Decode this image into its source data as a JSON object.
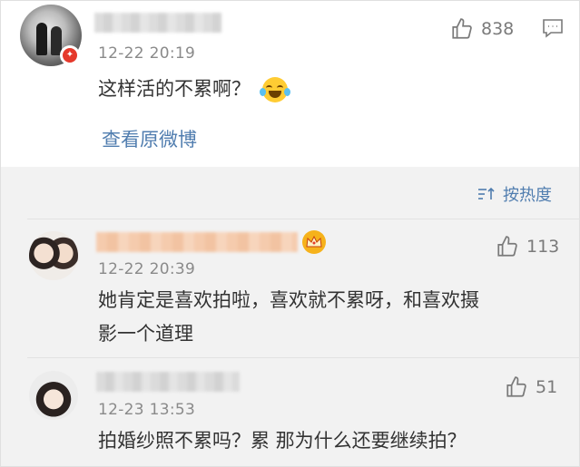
{
  "post": {
    "time": "12-22 20:19",
    "likes": "838",
    "text": "这样活的不累啊？",
    "emoji_icon": "laughing-crying-emoji-icon",
    "view_original": "查看原微博"
  },
  "sort_label": "按热度",
  "replies": [
    {
      "time": "12-22 20:39",
      "likes": "113",
      "text_line1": "她肯定是喜欢拍啦，喜欢就不累呀，和喜欢摄",
      "text_line2": "影一个道理"
    },
    {
      "time": "12-23 13:53",
      "likes": "51",
      "text_line1": "拍婚纱照不累吗？累 那为什么还要继续拍？"
    }
  ],
  "colors": {
    "link": "#507daf",
    "text": "#333333",
    "meta": "#8a8a8a",
    "background": "#f2f2f2"
  }
}
